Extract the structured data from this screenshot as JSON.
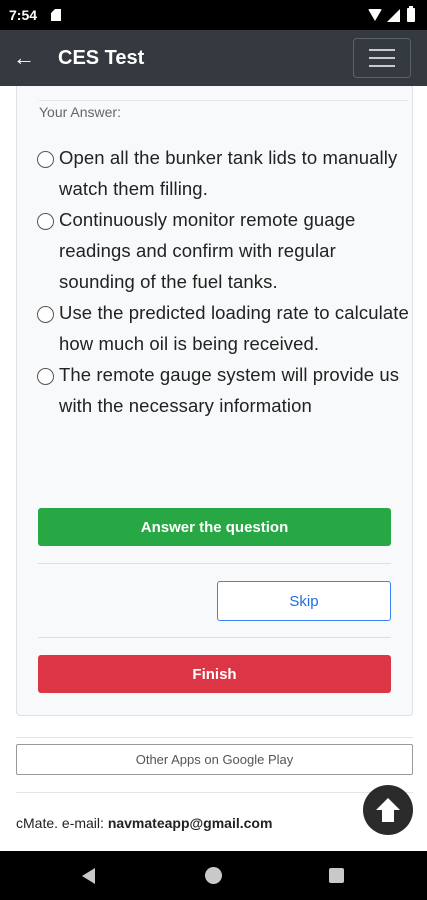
{
  "status_bar": {
    "time": "7:54"
  },
  "app_bar": {
    "back_symbol": "←",
    "title": "CES Test"
  },
  "question": {
    "your_answer_label": "Your Answer:",
    "options": [
      {
        "text": "Open all the bunker tank lids to manually watch them filling."
      },
      {
        "text": "Continuously monitor remote guage readings and confirm with regular sounding of the fuel tanks."
      },
      {
        "text": "Use the predicted loading rate to calculate how much oil is being received."
      },
      {
        "text": "The remote gauge system will provide us with the necessary information"
      }
    ]
  },
  "buttons": {
    "answer": "Answer the question",
    "skip": "Skip",
    "finish": "Finish",
    "other_apps": "Other Apps on Google Play"
  },
  "footer": {
    "prefix": "cMate. e-mail: ",
    "email": "navmateapp@gmail.com"
  },
  "colors": {
    "app_bar": "#343a40",
    "answer_button": "#28a745",
    "finish_button": "#dc3545",
    "skip_border": "#3b82f6"
  },
  "icons": {
    "back": "arrow-left-icon",
    "menu": "hamburger-menu-icon",
    "scroll_top": "arrow-up-circle-icon"
  }
}
